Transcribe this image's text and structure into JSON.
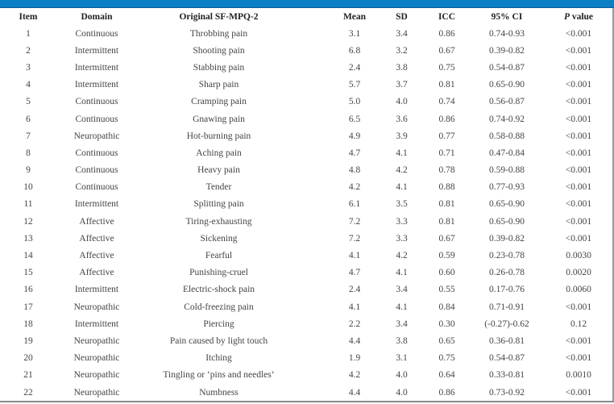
{
  "table": {
    "headers": {
      "item": "Item",
      "domain": "Domain",
      "original": "Original SF-MPQ-2",
      "mean": "Mean",
      "sd": "SD",
      "icc": "ICC",
      "ci": "95% CI",
      "p_italic": "P",
      "p_rest": " value"
    },
    "rows": [
      {
        "item": "1",
        "domain": "Continuous",
        "original": "Throbbing pain",
        "mean": "3.1",
        "sd": "3.4",
        "icc": "0.86",
        "ci": "0.74-0.93",
        "p": "<0.001"
      },
      {
        "item": "2",
        "domain": "Intermittent",
        "original": "Shooting pain",
        "mean": "6.8",
        "sd": "3.2",
        "icc": "0.67",
        "ci": "0.39-0.82",
        "p": "<0.001"
      },
      {
        "item": "3",
        "domain": "Intermittent",
        "original": "Stabbing pain",
        "mean": "2.4",
        "sd": "3.8",
        "icc": "0.75",
        "ci": "0.54-0.87",
        "p": "<0.001"
      },
      {
        "item": "4",
        "domain": "Intermittent",
        "original": "Sharp pain",
        "mean": "5.7",
        "sd": "3.7",
        "icc": "0.81",
        "ci": "0.65-0.90",
        "p": "<0.001"
      },
      {
        "item": "5",
        "domain": "Continuous",
        "original": "Cramping pain",
        "mean": "5.0",
        "sd": "4.0",
        "icc": "0.74",
        "ci": "0.56-0.87",
        "p": "<0.001"
      },
      {
        "item": "6",
        "domain": "Continuous",
        "original": "Gnawing pain",
        "mean": "6.5",
        "sd": "3.6",
        "icc": "0.86",
        "ci": "0.74-0.92",
        "p": "<0.001"
      },
      {
        "item": "7",
        "domain": "Neuropathic",
        "original": "Hot-burning pain",
        "mean": "4.9",
        "sd": "3.9",
        "icc": "0.77",
        "ci": "0.58-0.88",
        "p": "<0.001"
      },
      {
        "item": "8",
        "domain": "Continuous",
        "original": "Aching pain",
        "mean": "4.7",
        "sd": "4.1",
        "icc": "0.71",
        "ci": "0.47-0.84",
        "p": "<0.001"
      },
      {
        "item": "9",
        "domain": "Continuous",
        "original": "Heavy pain",
        "mean": "4.8",
        "sd": "4.2",
        "icc": "0.78",
        "ci": "0.59-0.88",
        "p": "<0.001"
      },
      {
        "item": "10",
        "domain": "Continuous",
        "original": "Tender",
        "mean": "4.2",
        "sd": "4.1",
        "icc": "0.88",
        "ci": "0.77-0.93",
        "p": "<0.001"
      },
      {
        "item": "11",
        "domain": "Intermittent",
        "original": "Splitting pain",
        "mean": "6.1",
        "sd": "3.5",
        "icc": "0.81",
        "ci": "0.65-0.90",
        "p": "<0.001"
      },
      {
        "item": "12",
        "domain": "Affective",
        "original": "Tiring-exhausting",
        "mean": "7.2",
        "sd": "3.3",
        "icc": "0.81",
        "ci": "0.65-0.90",
        "p": "<0.001"
      },
      {
        "item": "13",
        "domain": "Affective",
        "original": "Sickening",
        "mean": "7.2",
        "sd": "3.3",
        "icc": "0.67",
        "ci": "0.39-0.82",
        "p": "<0.001"
      },
      {
        "item": "14",
        "domain": "Affective",
        "original": "Fearful",
        "mean": "4.1",
        "sd": "4.2",
        "icc": "0.59",
        "ci": "0.23-0.78",
        "p": "0.0030"
      },
      {
        "item": "15",
        "domain": "Affective",
        "original": "Punishing-cruel",
        "mean": "4.7",
        "sd": "4.1",
        "icc": "0.60",
        "ci": "0.26-0.78",
        "p": "0.0020"
      },
      {
        "item": "16",
        "domain": "Intermittent",
        "original": "Electric-shock pain",
        "mean": "2.4",
        "sd": "3.4",
        "icc": "0.55",
        "ci": "0.17-0.76",
        "p": "0.0060"
      },
      {
        "item": "17",
        "domain": "Neuropathic",
        "original": "Cold-freezing pain",
        "mean": "4.1",
        "sd": "4.1",
        "icc": "0.84",
        "ci": "0.71-0.91",
        "p": "<0.001"
      },
      {
        "item": "18",
        "domain": "Intermittent",
        "original": "Piercing",
        "mean": "2.2",
        "sd": "3.4",
        "icc": "0.30",
        "ci": "(-0.27)-0.62",
        "p": "0.12"
      },
      {
        "item": "19",
        "domain": "Neuropathic",
        "original": "Pain caused by light touch",
        "mean": "4.4",
        "sd": "3.8",
        "icc": "0.65",
        "ci": "0.36-0.81",
        "p": "<0.001"
      },
      {
        "item": "20",
        "domain": "Neuropathic",
        "original": "Itching",
        "mean": "1.9",
        "sd": "3.1",
        "icc": "0.75",
        "ci": "0.54-0.87",
        "p": "<0.001"
      },
      {
        "item": "21",
        "domain": "Neuropathic",
        "original": "Tingling or ‘pins and needles’",
        "mean": "4.2",
        "sd": "4.0",
        "icc": "0.64",
        "ci": "0.33-0.81",
        "p": "0.0010"
      },
      {
        "item": "22",
        "domain": "Neuropathic",
        "original": "Numbness",
        "mean": "4.4",
        "sd": "4.0",
        "icc": "0.86",
        "ci": "0.73-0.92",
        "p": "<0.001"
      }
    ]
  }
}
